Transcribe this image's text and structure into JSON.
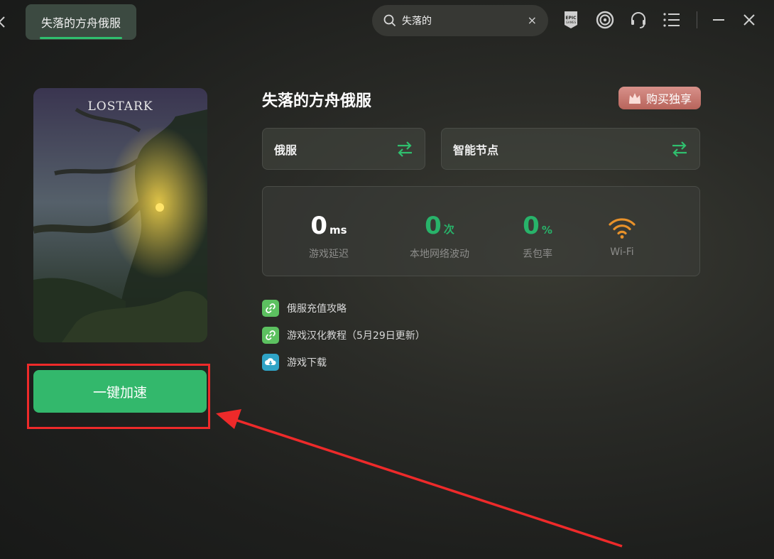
{
  "titlebar": {
    "active_tab": "失落的方舟俄服",
    "search": {
      "value": "失落的",
      "clear_symbol": "×"
    },
    "icons": [
      "back-chevron-icon",
      "epic-games-icon",
      "ubisoft-icon",
      "headset-support-icon",
      "menu-list-icon",
      "minimize-icon",
      "close-icon"
    ]
  },
  "cover": {
    "logo": "LOSTARK"
  },
  "main": {
    "title": "失落的方舟俄服",
    "buy_button": "购买独享",
    "region_selector": "俄服",
    "node_selector": "智能节点"
  },
  "stats": {
    "latency": {
      "value": "0",
      "unit": "ms",
      "label": "游戏延迟"
    },
    "jitter": {
      "value": "0",
      "unit": "次",
      "label": "本地网络波动"
    },
    "loss": {
      "value": "0",
      "unit": "%",
      "label": "丢包率"
    },
    "wifi": {
      "label": "Wi-Fi"
    }
  },
  "links": [
    {
      "label": "俄服充值攻略",
      "icon": "link-icon"
    },
    {
      "label": "游戏汉化教程（5月29日更新）",
      "icon": "link-icon"
    },
    {
      "label": "游戏下载",
      "icon": "cloud-download-icon"
    }
  ],
  "accelerate_button": "一键加速",
  "colors": {
    "accent_green": "#33b86c",
    "stat_green": "#28b36a",
    "wifi_orange": "#e9922a",
    "highlight_red": "#ee2a2a",
    "buy_button": "#c4766d"
  }
}
